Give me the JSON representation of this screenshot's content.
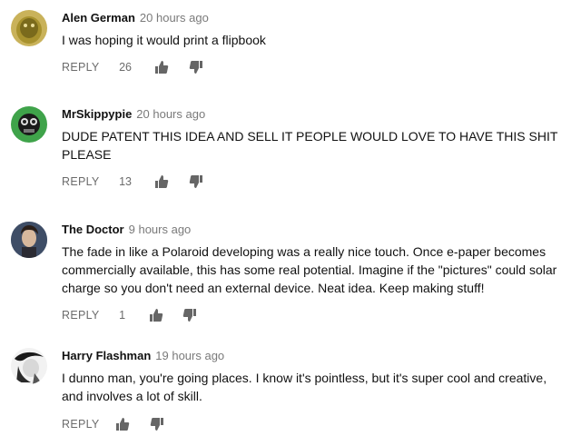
{
  "reply_label": "REPLY",
  "comments": [
    {
      "author": "Alen German",
      "time": "20 hours ago",
      "text": "I was hoping it would print a flipbook",
      "likes": "26"
    },
    {
      "author": "MrSkippypie",
      "time": "20 hours ago",
      "text": "DUDE PATENT THIS IDEA AND SELL IT PEOPLE WOULD LOVE TO HAVE THIS SHIT PLEASE",
      "likes": "13"
    },
    {
      "author": "The Doctor",
      "time": "9 hours ago",
      "text": "The fade in like a Polaroid developing was a really nice touch. Once e-paper becomes commercially available, this has some real potential. Imagine if the \"pictures\" could solar charge so you don't need an external device. Neat idea. Keep making stuff!",
      "likes": "1"
    },
    {
      "author": "Harry Flashman",
      "time": "19 hours ago",
      "text": "I dunno man, you're going places. I know it's pointless, but it's super cool and creative, and involves a lot of skill.",
      "likes": ""
    }
  ],
  "icons": {
    "like": "thumbs-up-icon",
    "dislike": "thumbs-down-icon"
  },
  "colors": {
    "author": "#111111",
    "timestamp": "#7a7a7a",
    "action": "#6b6b6b"
  }
}
